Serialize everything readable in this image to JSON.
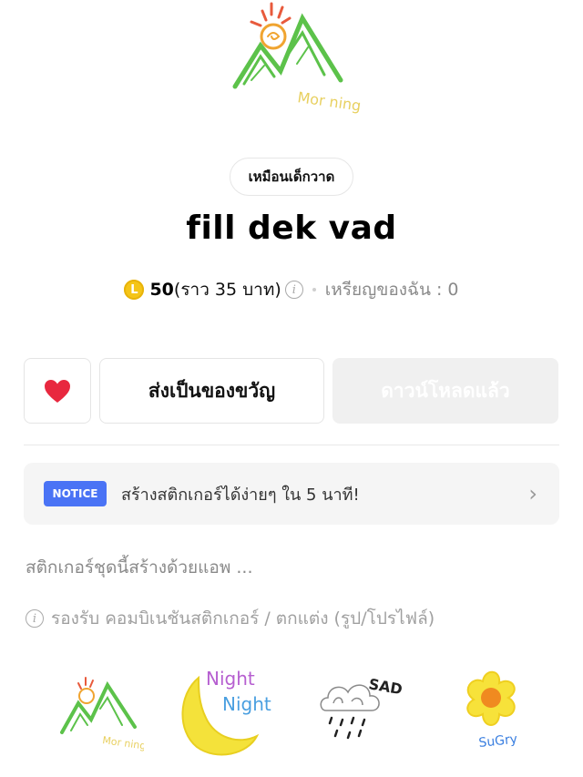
{
  "package": {
    "author": "เหมือนเด็กวาด",
    "title": "fill dek vad",
    "coin_symbol": "L",
    "price": "50",
    "price_note": "(ราว 35 บาท)",
    "my_coins": "เหรียญของฉัน : 0",
    "description": "สติกเกอร์ชุดนี้สร้างด้วยแอพ ...",
    "support_text": "รองรับ คอมบิเนชันสติกเกอร์ / ตกแต่ง (รูป/โปรไฟล์)"
  },
  "actions": {
    "gift_label": "ส่งเป็นของขวัญ",
    "download_label": "ดาวน์โหลดแล้ว"
  },
  "notice": {
    "badge": "NOTICE",
    "text": "สร้างสติกเกอร์ได้ง่ายๆ ใน 5 นาที!"
  },
  "stickers": {
    "hero_caption": "Mor ning",
    "s1_caption": "Mor ning",
    "s2_caption_a": "Night",
    "s2_caption_b": "Night",
    "s3_caption": "SAD",
    "s4_caption": "SuGry"
  },
  "colors": {
    "accent_blue": "#4a73f5",
    "heart_red": "#e8283f",
    "coin_gold": "#f5c518"
  }
}
